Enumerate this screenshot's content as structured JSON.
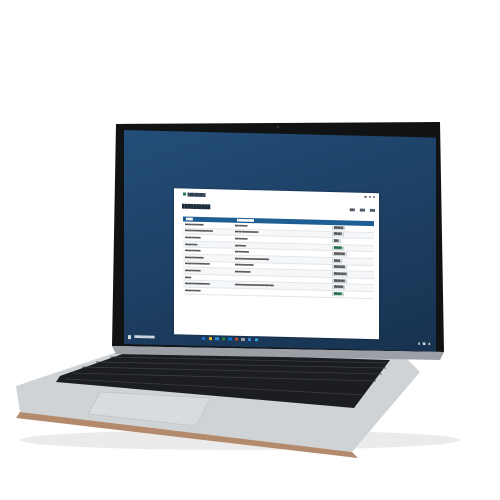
{
  "app": {
    "brand": "████████",
    "page_title": "██████████",
    "actions": [
      "███",
      "███",
      "███"
    ],
    "grid_header": [
      "████",
      "██████████"
    ],
    "rows": [
      {
        "c1": "████████████",
        "c2": "████████",
        "c3": "██████",
        "c4": "",
        "badge": false
      },
      {
        "c1": "██████████████████",
        "c2": "███████████████",
        "c3": "█████",
        "c4": "",
        "badge": false
      },
      {
        "c1": "██████████",
        "c2": "████████",
        "c3": "███",
        "c4": "",
        "badge": false
      },
      {
        "c1": "████████",
        "c2": "███████",
        "c3": "█████",
        "c4": "",
        "badge": true
      },
      {
        "c1": "██████████",
        "c2": "█████████",
        "c3": "███████",
        "c4": "",
        "badge": false
      },
      {
        "c1": "████████████",
        "c2": "██████████████████████",
        "c3": "████",
        "c4": "",
        "badge": false
      },
      {
        "c1": "████████████████",
        "c2": "████████████",
        "c3": "███████",
        "c4": "",
        "badge": false
      },
      {
        "c1": "██████████",
        "c2": "██████████",
        "c3": "████████",
        "c4": "",
        "badge": false
      },
      {
        "c1": "████",
        "c2": "",
        "c3": "███████",
        "c4": "",
        "badge": false
      },
      {
        "c1": "████████████████",
        "c2": "█████████████████████████",
        "c3": "██████",
        "c4": "",
        "badge": false
      },
      {
        "c1": "██████████",
        "c2": "",
        "c3": "█████",
        "c4": "",
        "badge": true
      }
    ]
  },
  "taskbar": {
    "search_text": "█████████████",
    "icon_colors": [
      "#1f6fd1",
      "#f0b429",
      "#2b8fd8",
      "#2e7d32",
      "#0b73c9",
      "#c44b2b",
      "#9e9e9e",
      "#3b8ad9",
      "#27a0d6"
    ],
    "tray_text": [
      "█",
      "██",
      "█"
    ]
  },
  "colors": {
    "desktop": "#1f4570",
    "grid_header": "#1f5e93",
    "laptop_body": "#cfd3d6",
    "keyboard": "#1b1d20"
  },
  "icons": [
    "windows-start-icon",
    "search-icon",
    "app-logo-icon"
  ]
}
